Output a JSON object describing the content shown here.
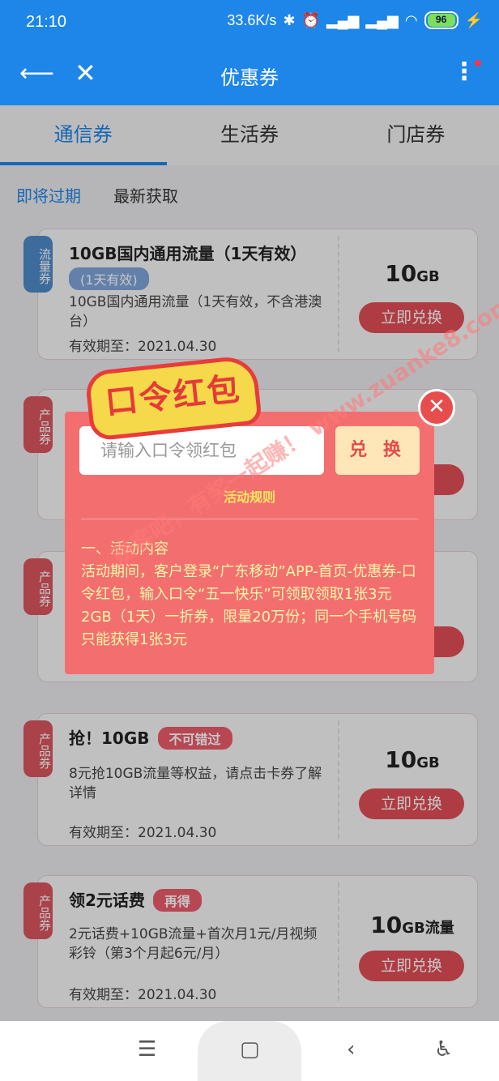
{
  "status": {
    "time": "21:10",
    "net_speed": "33.6K/s",
    "battery": "96"
  },
  "header": {
    "title": "优惠券"
  },
  "tabs": [
    "通信券",
    "生活券",
    "门店券"
  ],
  "subtabs": [
    "即将过期",
    "最新获取"
  ],
  "cards": [
    {
      "badge": "流量券",
      "title": "10GB国内通用流量（1天有效）",
      "tag": "(1天有效)",
      "desc": "10GB国内通用流量（1天有效，不含港澳台）",
      "valid": "有效期至：2021.04.30",
      "amount": "10",
      "unit": "GB",
      "button": "立即兑换"
    },
    {
      "badge": "产品券",
      "title": "",
      "tag": "",
      "desc": "",
      "valid": "",
      "amount": "",
      "unit": "",
      "button": ""
    },
    {
      "badge": "产品券",
      "title": "",
      "tag": "",
      "desc": "",
      "valid": "",
      "amount": "",
      "unit": "",
      "button": ""
    },
    {
      "badge": "产品券",
      "title": "抢！10GB",
      "tag": "不可错过",
      "desc": "8元抢10GB流量等权益，请点击卡券了解详情",
      "valid": "有效期至：2021.04.30",
      "amount": "10",
      "unit": "GB",
      "button": "立即兑换"
    },
    {
      "badge": "产品券",
      "title": "领2元话费",
      "tag": "再得",
      "desc": "2元话费+10GB流量+首次月1元/月视频彩铃（第3个月起6元/月）",
      "valid": "有效期至：2021.04.30",
      "amount": "10",
      "unit": "GB流量",
      "button": "立即兑换"
    }
  ],
  "modal": {
    "title": "口令红包",
    "input_placeholder": "请输入口令领红包",
    "redeem_label": "兑 换",
    "rules_label": "活动规则",
    "content": "一、活动内容\n活动期间，客户登录“广东移动”APP-首页-优惠券-口令红包，输入口令“五一快乐”可领取领取1张3元2GB（1天）一折券，限量20万份；同一个手机号码只能获得1张3元"
  },
  "watermark": "赚客吧，有奖一起赚！ www.zuanke8.com",
  "colors": {
    "accent": "#1d86e8",
    "modal_bg": "#f36f6f",
    "button_red": "#e14d57"
  }
}
